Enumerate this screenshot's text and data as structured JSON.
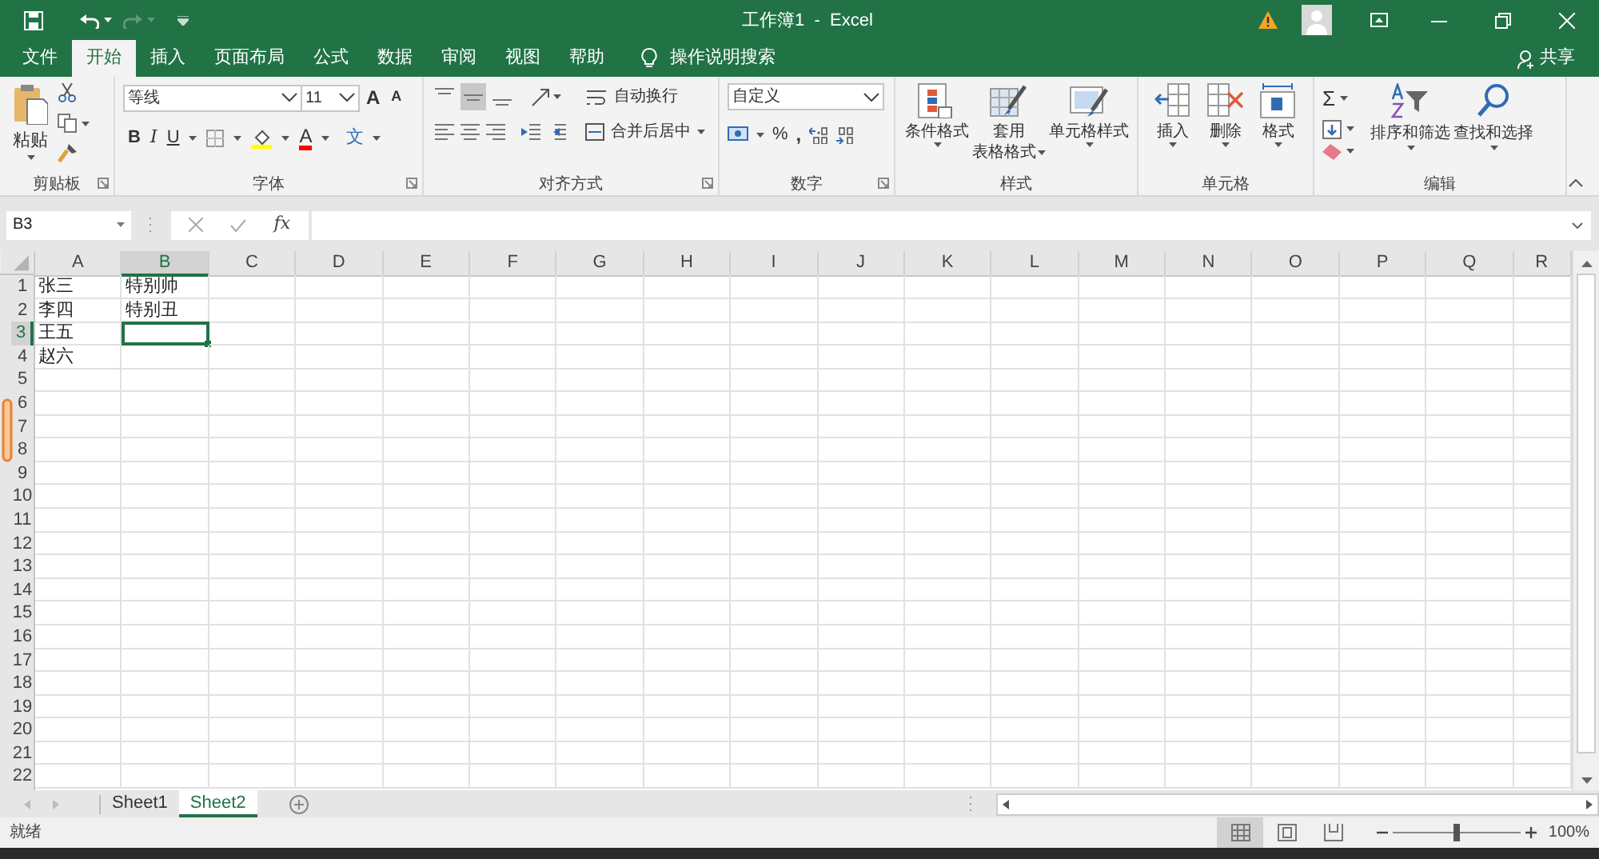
{
  "window": {
    "title": "工作簿1  -  Excel"
  },
  "quick_access": {
    "redo_disabled": true
  },
  "tabs": [
    {
      "label": "文件",
      "selected": false
    },
    {
      "label": "开始",
      "selected": true
    },
    {
      "label": "插入",
      "selected": false
    },
    {
      "label": "页面布局",
      "selected": false
    },
    {
      "label": "公式",
      "selected": false
    },
    {
      "label": "数据",
      "selected": false
    },
    {
      "label": "审阅",
      "selected": false
    },
    {
      "label": "视图",
      "selected": false
    },
    {
      "label": "帮助",
      "selected": false
    }
  ],
  "tell_me": "操作说明搜索",
  "share": "共享",
  "ribbon": {
    "clipboard": {
      "paste": "粘贴",
      "label": "剪贴板"
    },
    "font": {
      "font_name": "等线",
      "font_size": "11",
      "grow": "A",
      "shrink": "A",
      "bold": "B",
      "italic": "I",
      "underline": "U",
      "font_color": "A",
      "phonetic": "文",
      "label": "字体"
    },
    "alignment": {
      "vertical_align": [
        {
          "kind": "top",
          "selected": false
        },
        {
          "kind": "middle",
          "selected": true
        },
        {
          "kind": "bottom",
          "selected": false
        }
      ],
      "wrap": "自动换行",
      "merge": "合并后居中",
      "label": "对齐方式"
    },
    "number": {
      "format": "自定义",
      "percent": "%",
      "comma": ",",
      "label": "数字"
    },
    "styles": {
      "buttons": [
        {
          "kind": "conditional",
          "label_lines": [
            "条件格式"
          ]
        },
        {
          "kind": "table",
          "label_lines": [
            "套用",
            "表格格式"
          ]
        },
        {
          "kind": "cell",
          "label_lines": [
            "单元格样式"
          ]
        }
      ],
      "label": "样式"
    },
    "cells": {
      "buttons": [
        {
          "kind": "insert",
          "label_lines": [
            "插入"
          ]
        },
        {
          "kind": "delete",
          "label_lines": [
            "删除"
          ]
        },
        {
          "kind": "format",
          "label_lines": [
            "格式"
          ]
        }
      ],
      "label": "单元格"
    },
    "editing": {
      "sum": "Σ",
      "sort": "排序和筛选",
      "find": "查找和选择",
      "label": "编辑"
    }
  },
  "name_box": "B3",
  "formula_fx": "fx",
  "columns": [
    {
      "label": "A",
      "selected": false
    },
    {
      "label": "B",
      "selected": true
    },
    {
      "label": "C",
      "selected": false
    },
    {
      "label": "D",
      "selected": false
    },
    {
      "label": "E",
      "selected": false
    },
    {
      "label": "F",
      "selected": false
    },
    {
      "label": "G",
      "selected": false
    },
    {
      "label": "H",
      "selected": false
    },
    {
      "label": "I",
      "selected": false
    },
    {
      "label": "J",
      "selected": false
    },
    {
      "label": "K",
      "selected": false
    },
    {
      "label": "L",
      "selected": false
    },
    {
      "label": "M",
      "selected": false
    },
    {
      "label": "N",
      "selected": false
    },
    {
      "label": "O",
      "selected": false
    },
    {
      "label": "P",
      "selected": false
    },
    {
      "label": "Q",
      "selected": false
    },
    {
      "label": "R",
      "selected": false
    }
  ],
  "rows": [
    {
      "label": "1",
      "selected": false,
      "cells": [
        "张三",
        "特别帅"
      ]
    },
    {
      "label": "2",
      "selected": false,
      "cells": [
        "李四",
        "特别丑"
      ]
    },
    {
      "label": "3",
      "selected": true,
      "cells": [
        "王五"
      ]
    },
    {
      "label": "4",
      "selected": false,
      "cells": [
        "赵六"
      ]
    },
    {
      "label": "5",
      "selected": false
    },
    {
      "label": "6",
      "selected": false
    },
    {
      "label": "7",
      "selected": false
    },
    {
      "label": "8",
      "selected": false
    },
    {
      "label": "9",
      "selected": false
    },
    {
      "label": "10",
      "selected": false
    },
    {
      "label": "11",
      "selected": false
    },
    {
      "label": "12",
      "selected": false
    },
    {
      "label": "13",
      "selected": false
    },
    {
      "label": "14",
      "selected": false
    },
    {
      "label": "15",
      "selected": false
    },
    {
      "label": "16",
      "selected": false
    },
    {
      "label": "17",
      "selected": false
    },
    {
      "label": "18",
      "selected": false
    },
    {
      "label": "19",
      "selected": false
    },
    {
      "label": "20",
      "selected": false
    },
    {
      "label": "21",
      "selected": false
    },
    {
      "label": "22",
      "selected": false
    }
  ],
  "sheets": [
    {
      "label": "Sheet1",
      "selected": false
    },
    {
      "label": "Sheet2",
      "selected": true
    }
  ],
  "status": "就绪",
  "view_buttons": [
    {
      "kind": "normal",
      "selected": true
    },
    {
      "kind": "page_layout",
      "selected": false
    },
    {
      "kind": "page_break",
      "selected": false
    }
  ],
  "zoom": {
    "level": 0.5,
    "reading": "100%"
  }
}
